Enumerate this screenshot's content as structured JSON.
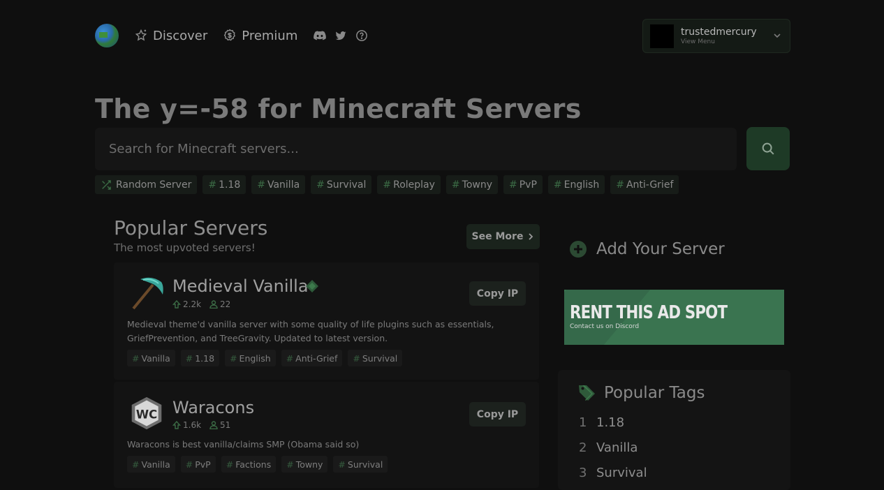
{
  "nav": {
    "discover": "Discover",
    "premium": "Premium",
    "user": {
      "name": "trustedmercury",
      "sub": "View Menu"
    }
  },
  "hero": {
    "title": "The y=-58 for Minecraft Servers",
    "search_placeholder": "Search for Minecraft servers..."
  },
  "quick_tags": {
    "random": "Random Server",
    "items": [
      "1.18",
      "Vanilla",
      "Survival",
      "Roleplay",
      "Towny",
      "PvP",
      "English",
      "Anti-Grief"
    ]
  },
  "popular": {
    "title": "Popular Servers",
    "subtitle": "The most upvoted servers!",
    "see_more": "See More",
    "servers": [
      {
        "name": "Medieval Vanilla",
        "upvotes": "2.2k",
        "players": "22",
        "copy_ip": "Copy IP",
        "description": "Medieval theme'd vanilla server with some quality of life plugins such as essentials, GriefPrevention, and TreeGravity. Updated to latest version.",
        "tags": [
          "Vanilla",
          "1.18",
          "English",
          "Anti-Grief",
          "Survival"
        ]
      },
      {
        "name": "Waracons",
        "upvotes": "1.6k",
        "players": "51",
        "copy_ip": "Copy IP",
        "description": "Waracons is best vanilla/claims SMP (Obama said so)",
        "tags": [
          "Vanilla",
          "PvP",
          "Factions",
          "Towny",
          "Survival"
        ]
      }
    ]
  },
  "sidebar": {
    "add_server": "Add Your Server",
    "ad": {
      "title": "RENT THIS AD SPOT",
      "subtitle": "Contact us on Discord"
    },
    "popular_tags": {
      "title": "Popular Tags",
      "items": [
        {
          "rank": "1",
          "label": "1.18"
        },
        {
          "rank": "2",
          "label": "Vanilla"
        },
        {
          "rank": "3",
          "label": "Survival"
        }
      ]
    }
  },
  "colors": {
    "accent_green": "#3a7450",
    "background": "#0f0f0f"
  }
}
